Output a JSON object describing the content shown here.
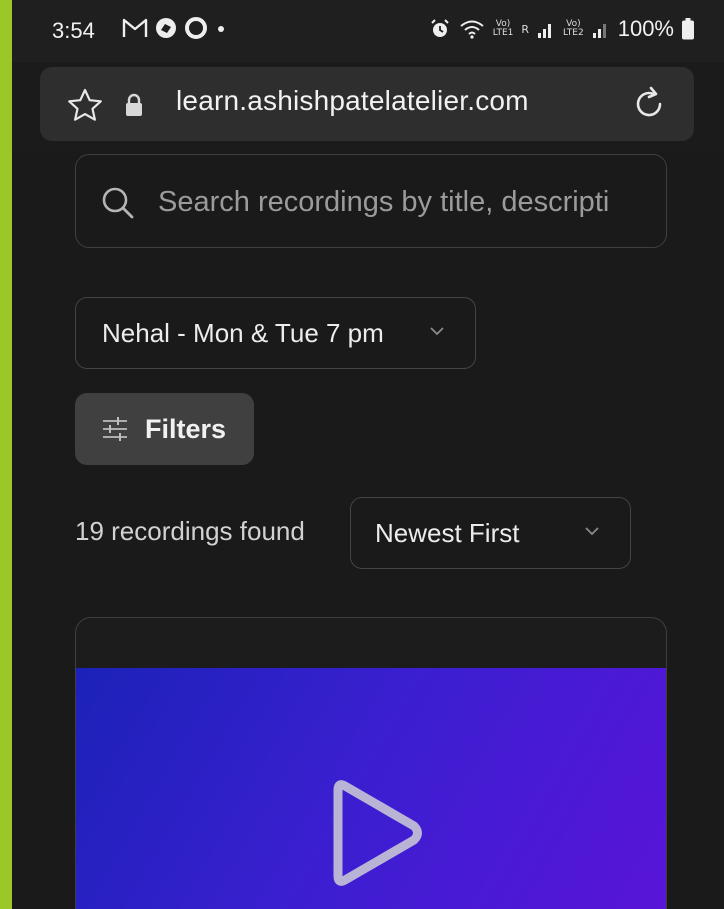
{
  "status_bar": {
    "time": "3:54",
    "battery": "100%",
    "net_label_1_top": "Vo)",
    "net_label_1_bottom": "LTE1",
    "net_label_2_top": "Vo)",
    "net_label_2_bottom": "LTE2",
    "roaming": "R"
  },
  "browser": {
    "url": "learn.ashishpatelatelier.com"
  },
  "search": {
    "placeholder": "Search recordings by title, descripti"
  },
  "class_select": {
    "value": "Nehal - Mon & Tue 7 pm"
  },
  "filters": {
    "label": "Filters"
  },
  "results": {
    "count_text": "19 recordings found",
    "sort_value": "Newest First"
  },
  "colors": {
    "accent_green": "#9cc728",
    "background": "#1a1a1a",
    "thumb_blue": "#1b22b8",
    "thumb_purple": "#5a14d8"
  }
}
